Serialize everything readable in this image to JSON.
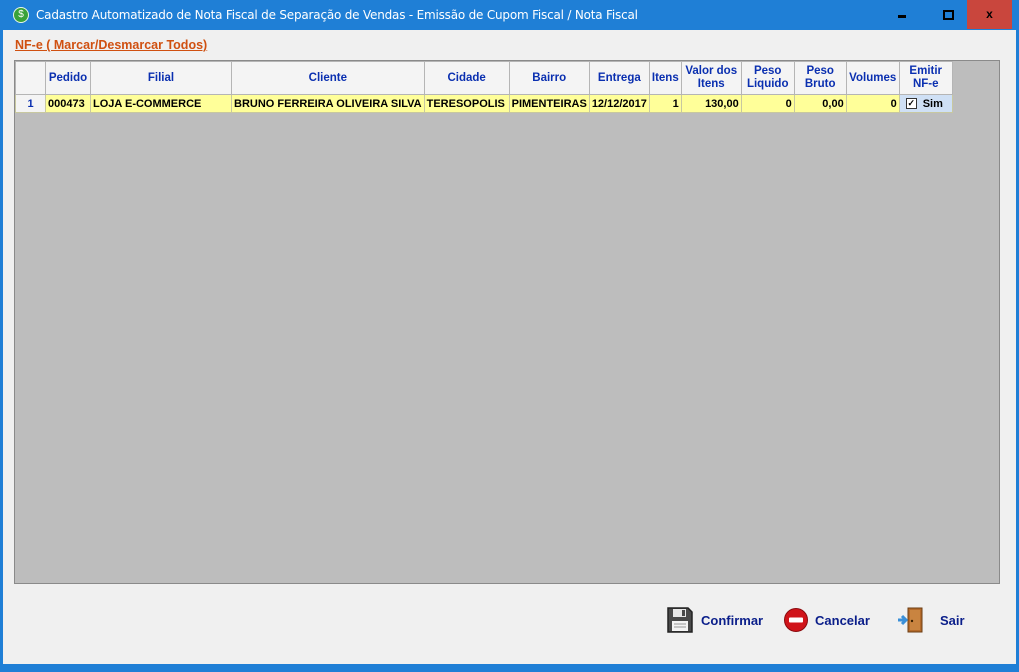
{
  "window": {
    "title": "Cadastro Automatizado de Nota Fiscal de Separação de Vendas - Emissão de Cupom Fiscal / Nota Fiscal",
    "controls": {
      "minimize": "–",
      "maximize": "□",
      "close": "x"
    }
  },
  "toggle_all_label": "NF-e ( Marcar/Desmarcar Todos)",
  "table": {
    "columns": [
      "Pedido",
      "Filial",
      "Cliente",
      "Cidade",
      "Bairro",
      "Entrega",
      "Itens",
      "Valor dos Itens",
      "Peso Liquido",
      "Peso Bruto",
      "Volumes",
      "Emitir NF-e"
    ],
    "rows": [
      {
        "row_no": "1",
        "pedido": "000473",
        "filial": "LOJA E-COMMERCE",
        "cliente": "BRUNO FERREIRA OLIVEIRA SILVA",
        "cidade": "TERESOPOLIS",
        "bairro": "PIMENTEIRAS",
        "entrega": "12/12/2017",
        "itens": "1",
        "valor": "130,00",
        "peso_liquido": "0",
        "peso_bruto": "0,00",
        "volumes": "0",
        "emitir_checked": true,
        "emitir_label": "Sim"
      }
    ]
  },
  "buttons": {
    "confirmar": {
      "label_ul": "C",
      "label_rest": "onfirmar",
      "icon": "floppy-disk-icon"
    },
    "cancelar": {
      "label_pre": "Ca",
      "label_ul": "n",
      "label_rest": "celar",
      "icon": "no-entry-icon"
    },
    "sair": {
      "label_ul": "S",
      "label_rest": "air",
      "icon": "exit-door-icon"
    }
  },
  "colors": {
    "titlebar": "#1f7fd6",
    "close_button": "#c9463d",
    "row_highlight": "#ffff99",
    "header_text": "#0a2fb0",
    "link_orange": "#d05010"
  }
}
